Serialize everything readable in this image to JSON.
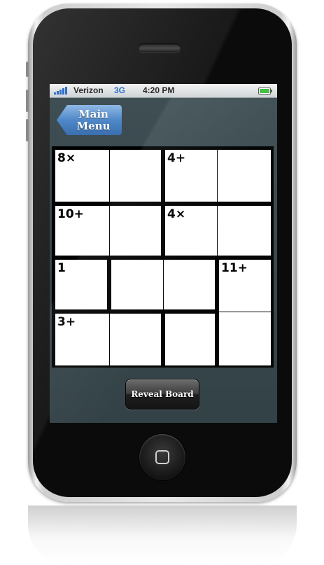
{
  "status_bar": {
    "carrier": "Verizon",
    "network": "3G",
    "time": "4:20 PM",
    "signal_icon": "signal-bars-icon",
    "battery_icon": "battery-icon",
    "battery_level": 1.0,
    "network_color": "#2e6fc9",
    "battery_color": "#3fbf3f"
  },
  "nav": {
    "main_menu_line1": "Main",
    "main_menu_line2": "Menu"
  },
  "board": {
    "size": 4,
    "clues": [
      {
        "row": 0,
        "col": 0,
        "text": "8×"
      },
      {
        "row": 0,
        "col": 2,
        "text": "4+"
      },
      {
        "row": 1,
        "col": 0,
        "text": "10+"
      },
      {
        "row": 1,
        "col": 2,
        "text": "4×"
      },
      {
        "row": 2,
        "col": 0,
        "text": "1"
      },
      {
        "row": 2,
        "col": 3,
        "text": "11+"
      },
      {
        "row": 3,
        "col": 0,
        "text": "3+"
      }
    ],
    "cages": [
      [
        [
          0,
          0
        ],
        [
          0,
          1
        ]
      ],
      [
        [
          0,
          2
        ],
        [
          0,
          3
        ]
      ],
      [
        [
          1,
          0
        ],
        [
          1,
          1
        ]
      ],
      [
        [
          1,
          2
        ],
        [
          1,
          3
        ]
      ],
      [
        [
          2,
          0
        ]
      ],
      [
        [
          2,
          1
        ],
        [
          2,
          2
        ]
      ],
      [
        [
          2,
          3
        ],
        [
          3,
          3
        ]
      ],
      [
        [
          3,
          0
        ],
        [
          3,
          1
        ]
      ],
      [
        [
          3,
          2
        ]
      ]
    ]
  },
  "actions": {
    "reveal_label": "Reveal Board"
  },
  "colors": {
    "accent_blue": "#4f88c8",
    "screen_bg": "#3a4a50"
  }
}
